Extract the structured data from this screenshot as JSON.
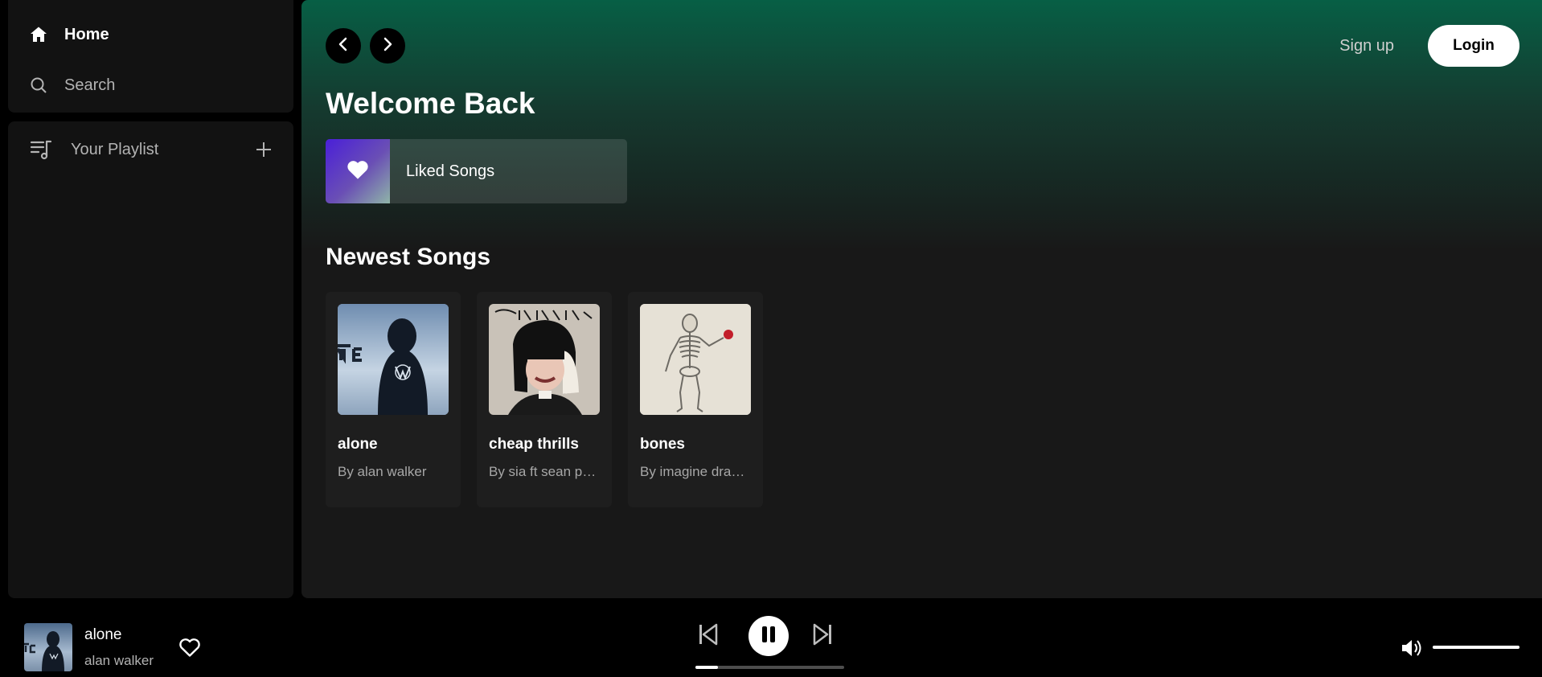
{
  "sidebar": {
    "nav": [
      {
        "label": "Home",
        "icon": "home-icon"
      },
      {
        "label": "Search",
        "icon": "search-icon"
      }
    ],
    "library": {
      "label": "Your Playlist",
      "icon": "playlist-icon",
      "add_icon": "plus-icon"
    }
  },
  "header": {
    "back_icon": "chevron-left-icon",
    "forward_icon": "chevron-right-icon",
    "signup_label": "Sign up",
    "login_label": "Login"
  },
  "main": {
    "welcome": "Welcome Back",
    "liked_songs": "Liked Songs",
    "newest_title": "Newest Songs",
    "songs": [
      {
        "title": "alone",
        "subtitle": "By alan walker"
      },
      {
        "title": "cheap thrills",
        "subtitle": "By sia ft sean paul"
      },
      {
        "title": "bones",
        "subtitle": "By imagine dragons"
      }
    ]
  },
  "player": {
    "title": "alone",
    "artist": "alan walker",
    "progress": 0.15,
    "volume": 1.0,
    "state": "playing"
  },
  "colors": {
    "accent_green": "#075f45",
    "surface": "#121212",
    "main_bg": "#181818"
  }
}
